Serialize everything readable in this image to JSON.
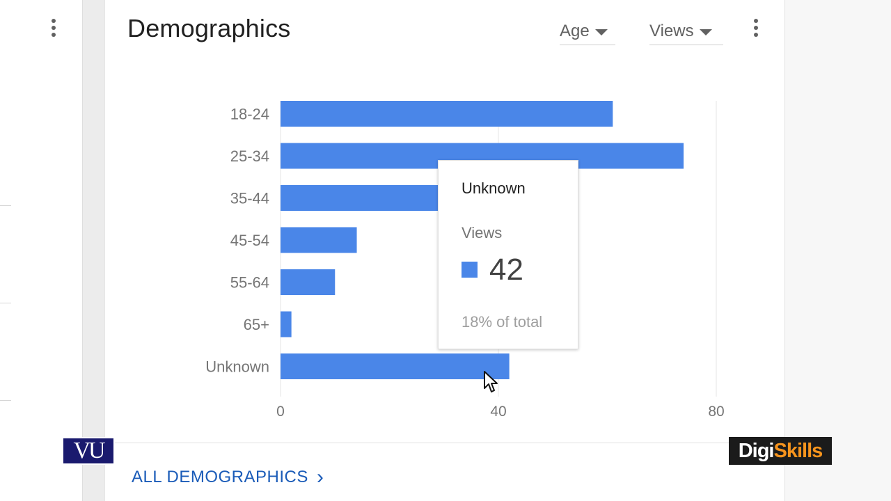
{
  "card": {
    "title": "Demographics",
    "dimension_dropdown": "Age",
    "metric_dropdown": "Views",
    "footer_link": "ALL DEMOGRAPHICS",
    "footer_chevron": "›"
  },
  "tooltip": {
    "title": "Unknown",
    "metric": "Views",
    "value": "42",
    "share": "18% of total"
  },
  "logos": {
    "vu": "VU",
    "digi_part1": "Digi",
    "digi_part2": "Skills"
  },
  "colors": {
    "bar": "#4a86e8",
    "link": "#1a5bb8",
    "digi_accent": "#f7941d"
  },
  "icons": [
    "more-vert-icon",
    "caret-down-icon",
    "chevron-right-icon",
    "mouse-cursor-icon"
  ],
  "chart_data": {
    "type": "bar",
    "orientation": "horizontal",
    "categories": [
      "18-24",
      "25-34",
      "35-44",
      "45-54",
      "55-64",
      "65+",
      "Unknown"
    ],
    "series": [
      {
        "name": "Views",
        "values": [
          61,
          74,
          29,
          14,
          10,
          2,
          42
        ]
      }
    ],
    "xlim": [
      0,
      80
    ],
    "xticks": [
      "0",
      "40",
      "80"
    ],
    "grid": true
  }
}
